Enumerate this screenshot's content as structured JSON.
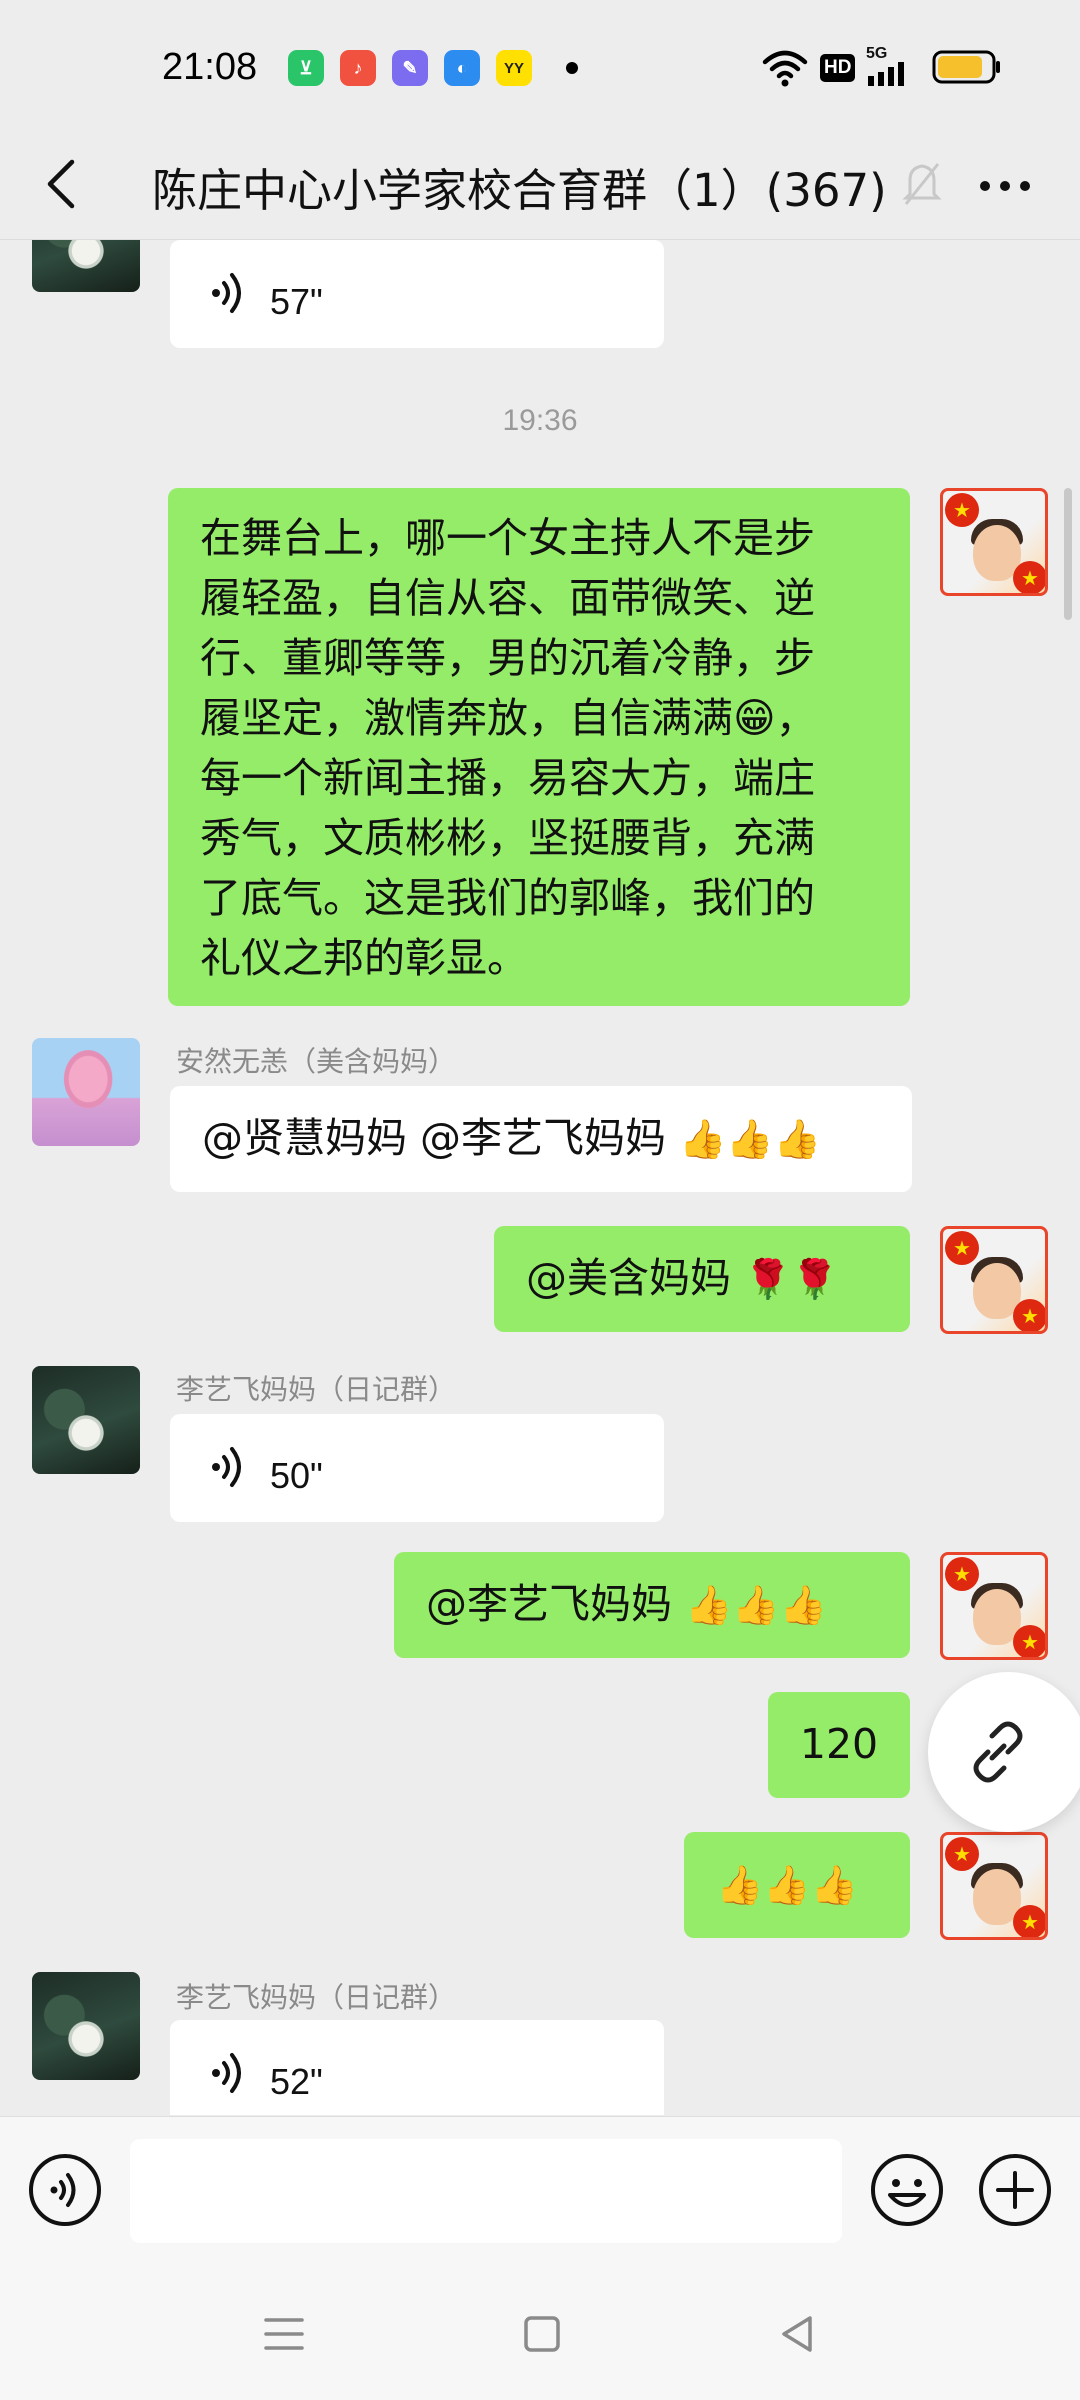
{
  "status_bar": {
    "time": "21:08",
    "apps": [
      {
        "name": "app-icon-green",
        "color": "#2bc569",
        "glyph": "⊻"
      },
      {
        "name": "music-app-icon",
        "color": "#f0523f",
        "glyph": "♪"
      },
      {
        "name": "edit-app-icon",
        "color": "#7b6cf0",
        "glyph": "✎"
      },
      {
        "name": "browser-app-icon",
        "color": "#2d8cf0",
        "glyph": "◐"
      },
      {
        "name": "yy-app-icon",
        "color": "#ffe000",
        "glyph": "YY"
      }
    ],
    "hd_label": "HD",
    "network_label": "5G",
    "battery_color": "#f5c02c"
  },
  "header": {
    "title": "陈庄中心小学家校合育群（1）(367)"
  },
  "messages": [
    {
      "kind": "voice",
      "side": "left",
      "duration": "57\""
    },
    {
      "kind": "time",
      "text": "19:36"
    },
    {
      "kind": "text",
      "side": "right",
      "lines": [
        "在舞台上，哪一个女主持人不是步",
        "履轻盈，自信从容、面带微笑、逆",
        "行、董卿等等，男的沉着冷静，步",
        "履坚定，激情奔放，自信满满😁，",
        "每一个新闻主播，易容大方，端庄",
        "秀气，文质彬彬，坚挺腰背，充满",
        "了底气。这是我们的郭峰，我们的",
        "礼仪之邦的彰显。"
      ]
    },
    {
      "kind": "text",
      "side": "left",
      "sender": "安然无恙（美含妈妈）",
      "text": "@贤慧妈妈 @李艺飞妈妈 "
    },
    {
      "kind": "text",
      "side": "right",
      "text": "@美含妈妈 "
    },
    {
      "kind": "voice",
      "side": "left",
      "sender": "李艺飞妈妈（日记群）",
      "duration": "50\""
    },
    {
      "kind": "text",
      "side": "right",
      "text": "@李艺飞妈妈 "
    },
    {
      "kind": "text",
      "side": "right",
      "text": "120"
    },
    {
      "kind": "emoji",
      "side": "right",
      "emojis": [
        "thumbs-up",
        "thumbs-up",
        "thumbs-up"
      ]
    },
    {
      "kind": "voice",
      "side": "left",
      "sender": "李艺飞妈妈（日记群）",
      "duration": "52\""
    }
  ],
  "colors": {
    "bubble_green": "#95ec69",
    "bubble_white": "#ffffff",
    "background": "#ededed",
    "sender_gray": "#8a8a8a"
  },
  "input": {
    "placeholder": ""
  }
}
